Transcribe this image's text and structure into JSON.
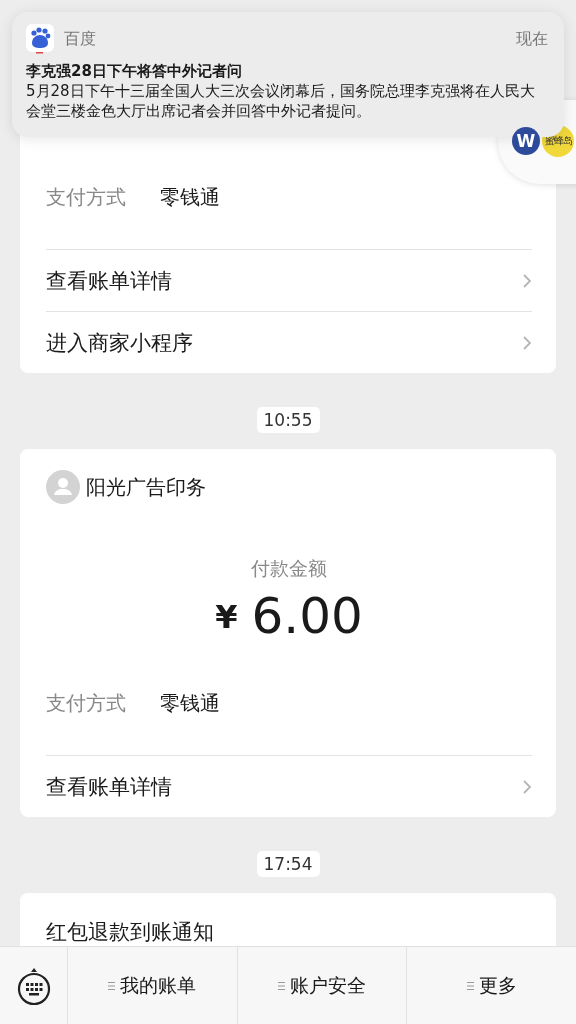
{
  "notification": {
    "app": "百度",
    "time": "现在",
    "title": "李克强28日下午将答中外记者问",
    "body": "5月28日下午十三届全国人大三次会议闭幕后，国务院总理李克强将在人民大会堂三楼金色大厅出席记者会并回答中外记者提问。"
  },
  "floating_widget": {
    "badge_1": "W",
    "badge_2": "蜜蜂岛"
  },
  "messages": [
    {
      "kind": "payment",
      "fields": [
        {
          "label": "支付方式",
          "value": "零钱通"
        }
      ],
      "links": [
        "查看账单详情",
        "进入商家小程序"
      ]
    },
    {
      "kind": "time",
      "text": "10:55"
    },
    {
      "kind": "payment",
      "merchant": "阳光广告印务",
      "amount_label": "付款金额",
      "currency": "¥",
      "amount": "6.00",
      "fields": [
        {
          "label": "支付方式",
          "value": "零钱通"
        }
      ],
      "links": [
        "查看账单详情"
      ]
    },
    {
      "kind": "time",
      "text": "17:54"
    },
    {
      "kind": "notice",
      "title": "红包退款到账通知"
    }
  ],
  "menu": {
    "items": [
      "我的账单",
      "账户安全",
      "更多"
    ]
  }
}
